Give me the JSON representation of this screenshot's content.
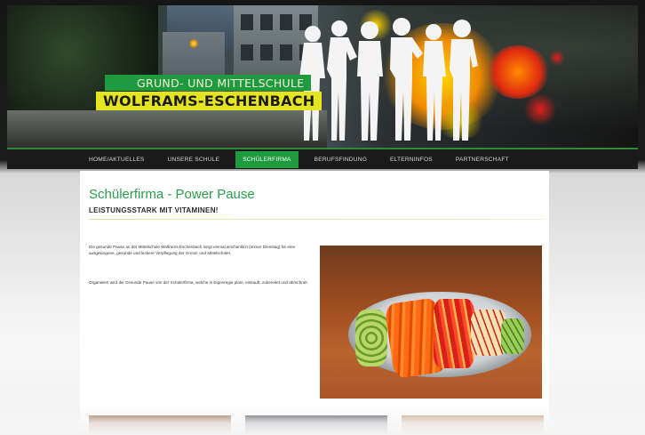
{
  "school": {
    "line1": "GRUND- UND MITTELSCHULE",
    "line2": "WOLFRAMS-ESCHENBACH"
  },
  "nav": {
    "items": [
      {
        "label": "Home/Aktuelles",
        "active": false
      },
      {
        "label": "Unsere Schule",
        "active": false
      },
      {
        "label": "Schülerfirma",
        "active": true
      },
      {
        "label": "Berufsfindung",
        "active": false
      },
      {
        "label": "Elterninfos",
        "active": false
      },
      {
        "label": "Partnerschaft",
        "active": false
      }
    ]
  },
  "main": {
    "title": "Schülerfirma - Power Pause",
    "subtitle": "LEISTUNGSSTARK MIT VITAMINEN!",
    "paragraph1": "Die gesunde Pause an der Mittelschule Wolframs-Eschenbach sorgt einmal wöchentlich (immer Dienstag) für eine ausgewogene, gesunde und leckere Verpflegung der Grund- und Mittelschüler.",
    "paragraph2": "Organisiert wird die Gesunde Pause von der Schülerfirma, welche in Eigenregie plant, einkauft, zubereitet und abrechnet."
  },
  "colors": {
    "accent_green": "#1e9b3e",
    "accent_yellow": "#e4e421",
    "nav_background": "#1a1a1a",
    "title_green": "#2a9e4a"
  },
  "icons": {
    "logo": "school-logo-silhouettes"
  }
}
